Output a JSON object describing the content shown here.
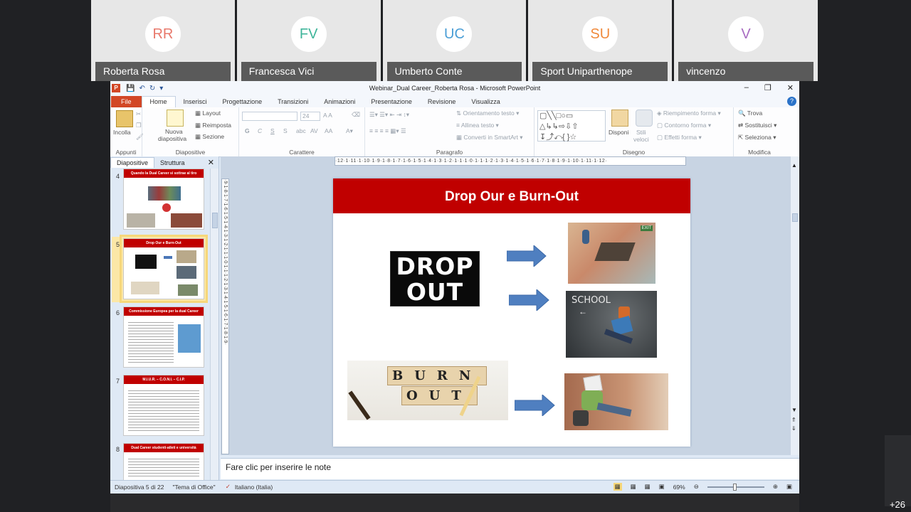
{
  "participants": [
    {
      "initials": "RR",
      "name": "Roberta Rosa",
      "color": "#e8786b"
    },
    {
      "initials": "FV",
      "name": "Francesca Vici",
      "color": "#3fb59a"
    },
    {
      "initials": "UC",
      "name": "Umberto Conte",
      "color": "#4a9ed6"
    },
    {
      "initials": "SU",
      "name": "Sport Uniparthenope",
      "color": "#f08a3c"
    },
    {
      "initials": "V",
      "name": "vincenzo",
      "color": "#a86cc1"
    }
  ],
  "more_participants": "+26",
  "window": {
    "title": "Webinar_Dual Career_Roberta Rosa - Microsoft PowerPoint",
    "app_icon": "P"
  },
  "tabs": [
    "File",
    "Home",
    "Inserisci",
    "Progettazione",
    "Transizioni",
    "Animazioni",
    "Presentazione",
    "Revisione",
    "Visualizza"
  ],
  "active_tab": "Home",
  "ribbon": {
    "appunti": {
      "label": "Appunti",
      "paste": "Incolla"
    },
    "diapositive": {
      "label": "Diapositive",
      "new_line1": "Nuova",
      "new_line2": "diapositiva",
      "layout": "Layout",
      "reset": "Reimposta",
      "section": "Sezione"
    },
    "carattere": {
      "label": "Carattere",
      "font_size": "24",
      "bold": "G",
      "italic": "C",
      "underline": "S",
      "strike": "S",
      "aa": "AA"
    },
    "paragrafo": {
      "label": "Paragrafo",
      "direction": "Orientamento testo",
      "align": "Allinea testo",
      "smartart": "Converti in SmartArt"
    },
    "disegno": {
      "label": "Disegno",
      "arrange": "Disponi",
      "styles_line1": "Stili",
      "styles_line2": "veloci",
      "fill": "Riempimento forma",
      "outline": "Contorno forma",
      "effects": "Effetti forma"
    },
    "modifica": {
      "label": "Modifica",
      "find": "Trova",
      "replace": "Sostituisci",
      "select": "Seleziona"
    }
  },
  "left_pane": {
    "tab_slides": "Diapositive",
    "tab_outline": "Struttura",
    "thumbnails": [
      {
        "num": "4",
        "title": "Quando la Dual Career si sottrae al tiro"
      },
      {
        "num": "5",
        "title": "Drop Our e Burn-Out"
      },
      {
        "num": "6",
        "title": "Commissione Europea per la dual Career"
      },
      {
        "num": "7",
        "title": "M.I.U.R. – C.O.N.I. – C.I.P."
      },
      {
        "num": "8",
        "title": "Dual Career studenti-atleti e università"
      }
    ]
  },
  "ruler": {
    "h": "·12·1·11·1·10·1·9·1·8·1·7·1·6·1·5·1·4·1·3·1·2·1·1·1·0·1·1·1·2·1·3·1·4·1·5·1·6·1·7·1·8·1·9·1·10·1·11·1·12·",
    "v": "·9·1·8·1·7·1·6·1·5·1·4·1·3·1·2·1·1·1·0·1·1·1·2·1·3·1·4·1·5·1·6·1·7·1·8·1·9·"
  },
  "slide": {
    "title": "Drop Our e Burn-Out",
    "dropout_line1": "DROP",
    "dropout_line2": "OUT",
    "burnout_top": "BURN",
    "burnout_bottom": "OUT",
    "school_sign": "SCHOOL",
    "exit_sign": "EXIT"
  },
  "notes_placeholder": "Fare clic per inserire le note",
  "status": {
    "slide_info": "Diapositiva 5 di 22",
    "theme": "\"Tema di Office\"",
    "language": "Italiano (Italia)",
    "zoom": "69%"
  }
}
